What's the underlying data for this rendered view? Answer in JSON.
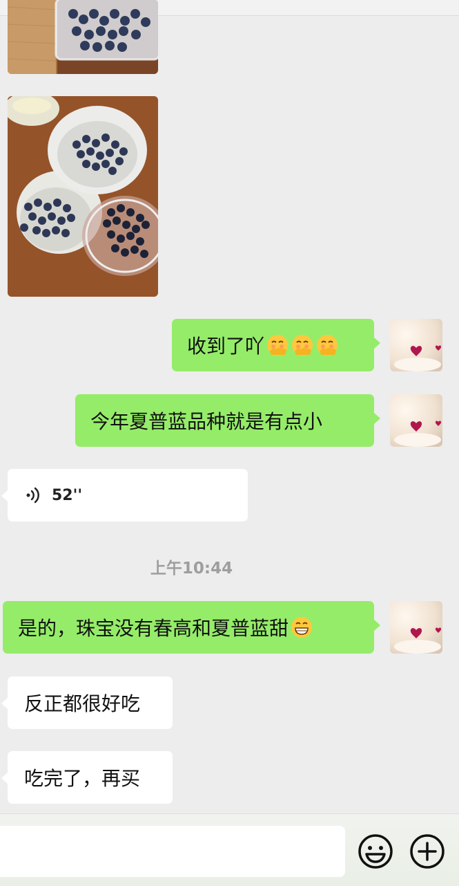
{
  "chat": {
    "messages": [
      {
        "side": "left",
        "type": "image",
        "content": "blueberries-in-box-photo"
      },
      {
        "side": "left",
        "type": "image",
        "content": "blueberries-in-bowls-photo"
      },
      {
        "side": "right",
        "type": "text",
        "text": "收到了吖",
        "emoji": [
          "smirk-hand-emoji",
          "smirk-hand-emoji",
          "smirk-hand-emoji"
        ]
      },
      {
        "side": "right",
        "type": "text",
        "text": "今年夏普蓝品种就是有点小"
      },
      {
        "side": "left",
        "type": "voice",
        "duration": "52''"
      },
      {
        "side": "right",
        "type": "text",
        "text": "是的，珠宝没有春高和夏普蓝甜",
        "emoji": [
          "grinning-emoji"
        ]
      },
      {
        "side": "left",
        "type": "text",
        "text": "反正都很好吃"
      },
      {
        "side": "left",
        "type": "text",
        "text": "吃完了，再买"
      }
    ],
    "timestamp": "上午10:44"
  },
  "input_bar": {
    "field_value": "",
    "icons": [
      "emoji-face-icon",
      "plus-circle-icon"
    ]
  },
  "colors": {
    "background": "#ededed",
    "outgoing_bubble": "#95ec69",
    "incoming_bubble": "#ffffff",
    "timestamp_text": "#9e9e9e"
  }
}
